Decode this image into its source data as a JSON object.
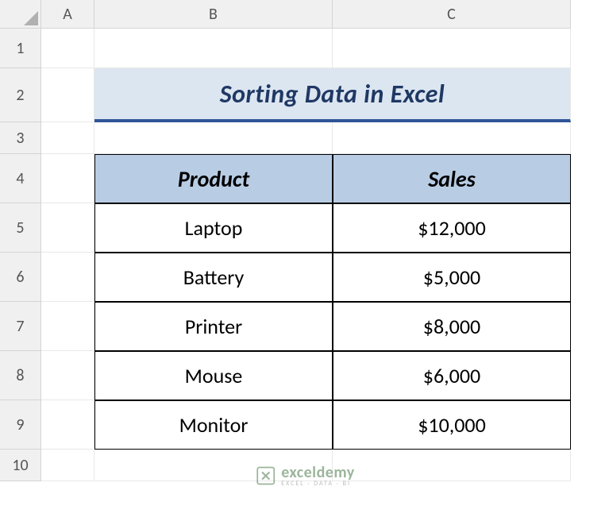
{
  "columns": [
    "A",
    "B",
    "C"
  ],
  "rows": [
    "1",
    "2",
    "3",
    "4",
    "5",
    "6",
    "7",
    "8",
    "9",
    "10"
  ],
  "title": "Sorting Data in Excel",
  "table": {
    "headers": {
      "product": "Product",
      "sales": "Sales"
    },
    "data": [
      {
        "product": "Laptop",
        "sales": "$12,000"
      },
      {
        "product": "Battery",
        "sales": "$5,000"
      },
      {
        "product": "Printer",
        "sales": "$8,000"
      },
      {
        "product": "Mouse",
        "sales": "$6,000"
      },
      {
        "product": "Monitor",
        "sales": "$10,000"
      }
    ]
  },
  "watermark": {
    "main": "exceldemy",
    "sub": "EXCEL · DATA · BI"
  }
}
